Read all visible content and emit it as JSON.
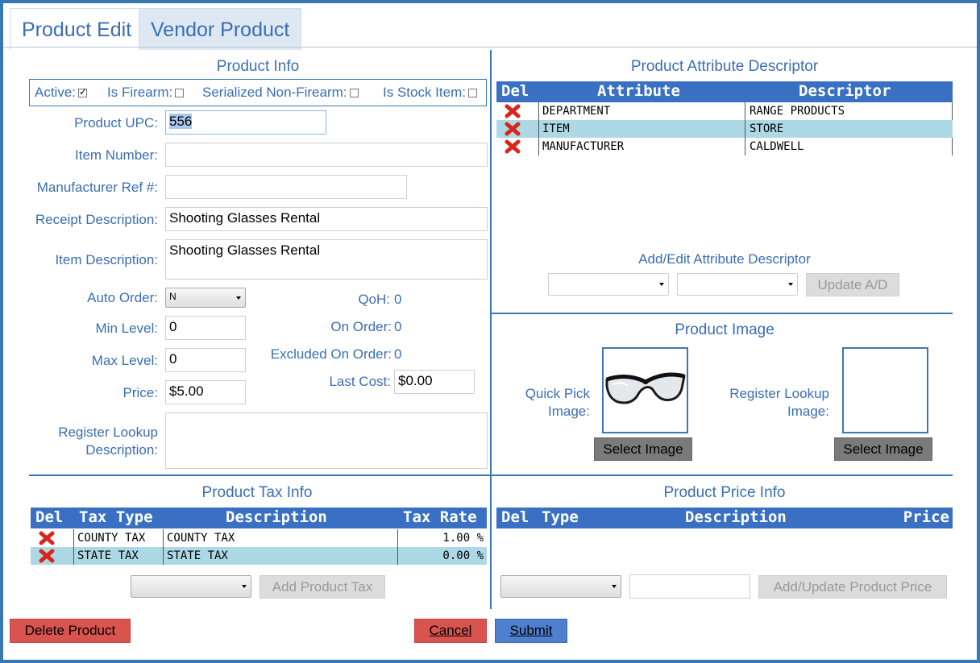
{
  "tabs": [
    {
      "label": "Product Edit",
      "active": true
    },
    {
      "label": "Vendor Product",
      "active": false
    }
  ],
  "product_info": {
    "title": "Product Info",
    "active_label": "Active:",
    "active_checked": true,
    "firearm_label": "Is Firearm:",
    "firearm_checked": false,
    "serialized_label": "Serialized Non-Firearm:",
    "serialized_checked": false,
    "stock_label": "Is Stock Item:",
    "stock_checked": false,
    "upc_label": "Product UPC:",
    "upc_value": "556",
    "item_number_label": "Item Number:",
    "item_number_value": "",
    "mfr_ref_label": "Manufacturer Ref #:",
    "mfr_ref_value": "",
    "receipt_desc_label": "Receipt Description:",
    "receipt_desc_value": "Shooting Glasses Rental",
    "item_desc_label": "Item Description:",
    "item_desc_value": "Shooting Glasses Rental",
    "auto_order_label": "Auto Order:",
    "auto_order_value": "N",
    "min_level_label": "Min Level:",
    "min_level_value": "0",
    "max_level_label": "Max Level:",
    "max_level_value": "0",
    "price_label": "Price:",
    "price_value": "$5.00",
    "register_lookup_label_1": "Register Lookup",
    "register_lookup_label_2": "Description:",
    "register_lookup_value": "",
    "qoh_label": "QoH:",
    "qoh_value": "0",
    "on_order_label": "On Order:",
    "on_order_value": "0",
    "excluded_label": "Excluded On Order:",
    "excluded_value": "0",
    "last_cost_label": "Last Cost:",
    "last_cost_value": "$0.00"
  },
  "attributes": {
    "title": "Product Attribute Descriptor",
    "headers": {
      "del": "Del",
      "attribute": "Attribute",
      "descriptor": "Descriptor"
    },
    "rows": [
      {
        "attribute": "DEPARTMENT",
        "descriptor": "RANGE PRODUCTS"
      },
      {
        "attribute": "ITEM",
        "descriptor": "STORE"
      },
      {
        "attribute": "MANUFACTURER",
        "descriptor": "CALDWELL"
      }
    ],
    "edit_title": "Add/Edit Attribute Descriptor",
    "update_label": "Update A/D"
  },
  "images": {
    "title": "Product Image",
    "quick_pick_label_1": "Quick Pick",
    "quick_pick_label_2": "Image:",
    "register_label_1": "Register Lookup",
    "register_label_2": "Image:",
    "select_label": "Select Image"
  },
  "tax": {
    "title": "Product Tax Info",
    "headers": {
      "del": "Del",
      "type": "Tax Type",
      "description": "Description",
      "rate": "Tax Rate"
    },
    "rows": [
      {
        "type": "COUNTY TAX",
        "description": "COUNTY TAX",
        "rate": "1.00 %"
      },
      {
        "type": "STATE TAX",
        "description": "STATE TAX",
        "rate": "0.00 %"
      }
    ],
    "add_label": "Add Product Tax"
  },
  "price": {
    "title": "Product Price Info",
    "headers": {
      "del": "Del",
      "type": "Type",
      "description": "Description",
      "price": "Price"
    },
    "add_label": "Add/Update Product Price",
    "price_input_value": ""
  },
  "footer": {
    "delete_label": "Delete Product",
    "cancel_label": "Cancel",
    "submit_label": "Submit"
  },
  "colors": {
    "accent": "#3a78b5",
    "grid_header": "#3a70c4",
    "row_alt": "#add8e6",
    "danger": "#d9534f",
    "primary": "#4f7fcf"
  }
}
